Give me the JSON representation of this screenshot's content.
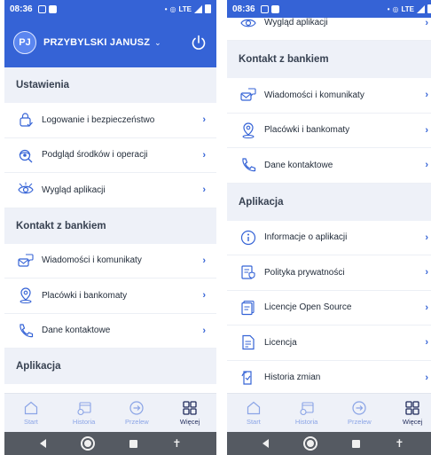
{
  "status_bar": {
    "time": "08:36",
    "network": "LTE"
  },
  "user": {
    "initials": "PJ",
    "name": "PRZYBYLSKI JANUSZ"
  },
  "sections": {
    "ustawienia": "Ustawienia",
    "kontakt": "Kontakt z bankiem",
    "aplikacja": "Aplikacja"
  },
  "items": {
    "logowanie": "Logowanie i bezpieczeństwo",
    "podglad": "Podgląd środków i operacji",
    "wyglad": "Wygląd aplikacji",
    "wiadomosci": "Wiadomości i komunikaty",
    "placowki": "Placówki i bankomaty",
    "dane": "Dane kontaktowe",
    "informacje": "Informacje o aplikacji",
    "polityka": "Polityka prywatności",
    "licencje_os": "Licencje Open Source",
    "licencja": "Licencja",
    "historia_zmian": "Historia zmian"
  },
  "bottom_nav": {
    "start": "Start",
    "historia": "Historia",
    "przelew": "Przelew",
    "wiecej": "Więcej"
  },
  "icons": {
    "accent": "#3563d6",
    "header": "#3563d6",
    "section_bg": "#eef1f8"
  }
}
